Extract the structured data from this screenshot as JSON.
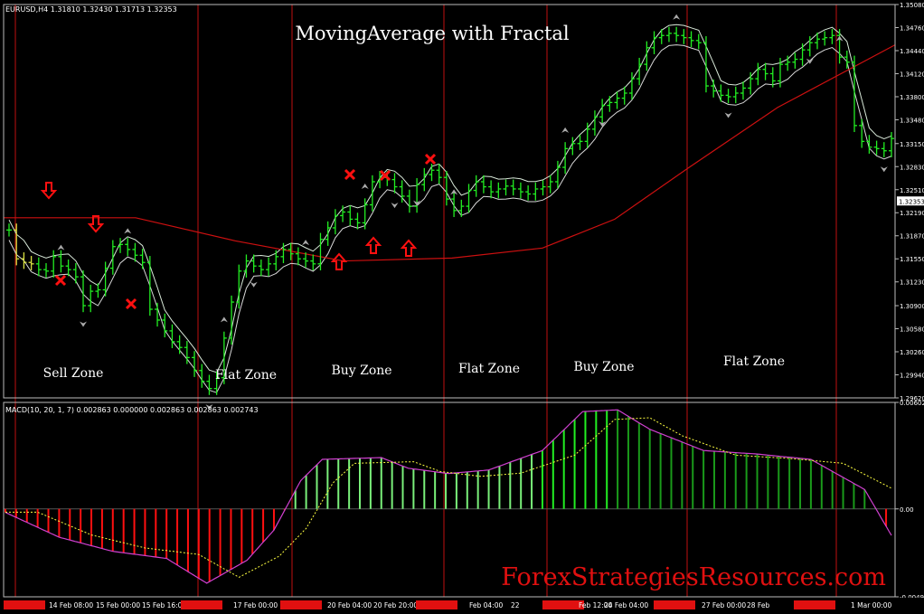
{
  "chart_data": [
    {
      "type": "candlestick",
      "symbol_info": "EURUSD,H4  1.31810 1.32430 1.31713 1.32353",
      "title": "MovingAverage with Fractal",
      "current_price_label": "1.32353",
      "ylim": [
        1.2962,
        1.3508
      ],
      "y_ticks": [
        "1.35080",
        "1.34760",
        "1.34440",
        "1.34120",
        "1.33800",
        "1.33480",
        "1.33150",
        "1.32830",
        "1.32510",
        "1.32190",
        "1.31870",
        "1.31550",
        "1.31230",
        "1.30900",
        "1.30580",
        "1.30260",
        "1.29940",
        "1.29620"
      ],
      "zones": [
        {
          "label": "Sell Zone"
        },
        {
          "label": "Flat Zone"
        },
        {
          "label": "Buy Zone"
        },
        {
          "label": "Flat Zone"
        },
        {
          "label": "Buy Zone"
        },
        {
          "label": "Flat Zone"
        }
      ],
      "bar_close": [
        1.3195,
        1.3155,
        1.315,
        1.3148,
        1.314,
        1.3138,
        1.3158,
        1.3145,
        1.314,
        1.313,
        1.309,
        1.311,
        1.3112,
        1.3142,
        1.3172,
        1.3175,
        1.3168,
        1.316,
        1.315,
        1.3085,
        1.307,
        1.3055,
        1.304,
        1.3032,
        1.3018,
        1.3,
        1.2985,
        1.2975,
        1.299,
        1.3045,
        1.3095,
        1.3138,
        1.3152,
        1.3145,
        1.314,
        1.3148,
        1.3158,
        1.3168,
        1.3162,
        1.3155,
        1.3152,
        1.3148,
        1.3182,
        1.3198,
        1.3215,
        1.322,
        1.321,
        1.3205,
        1.323,
        1.3262,
        1.3268,
        1.3265,
        1.3255,
        1.3242,
        1.3228,
        1.3258,
        1.3272,
        1.3278,
        1.3268,
        1.3238,
        1.3222,
        1.3228,
        1.325,
        1.3262,
        1.3255,
        1.3248,
        1.3252,
        1.3256,
        1.3252,
        1.3248,
        1.3245,
        1.3252,
        1.3255,
        1.3262,
        1.3282,
        1.3308,
        1.3315,
        1.3318,
        1.3335,
        1.3352,
        1.3368,
        1.3372,
        1.3378,
        1.3385,
        1.3405,
        1.3425,
        1.3448,
        1.3462,
        1.3465,
        1.3468,
        1.3465,
        1.3462,
        1.3458,
        1.3455,
        1.3395,
        1.3388,
        1.3382,
        1.338,
        1.3385,
        1.3392,
        1.3405,
        1.3418,
        1.3412,
        1.3402,
        1.3425,
        1.3428,
        1.3432,
        1.3445,
        1.3455,
        1.346,
        1.3462,
        1.3465,
        1.3435,
        1.3428,
        1.334,
        1.3318,
        1.331,
        1.3308,
        1.3305,
        1.3322
      ],
      "series": [
        {
          "name": "MA upper envelope",
          "color": "#d8e8d8"
        },
        {
          "name": "MA lower envelope",
          "color": "#d8d8d8"
        },
        {
          "name": "Slow MA",
          "color": "#cc1010"
        }
      ],
      "fractals_up_bar_index": [
        7,
        16,
        29,
        40,
        48,
        60,
        75,
        90,
        112
      ],
      "fractals_down_bar_index": [
        10,
        27,
        33,
        52,
        55,
        80,
        97,
        108,
        118
      ]
    },
    {
      "type": "bar",
      "indicator_label": "MACD(10, 20, 1, 7) 0.002863 0.000000 0.002863 0.002863 0.002743",
      "ylim": [
        -0.00497,
        0.00602
      ],
      "y_ticks": [
        "0.00602",
        "0.00",
        "-0.00497"
      ],
      "signal_color": "#ffff40",
      "macd_line_color": "#d040d0",
      "positive_color": "#22c822",
      "negative_color": "#ff1010",
      "zero_value": 0.0
    }
  ],
  "x_labels": [
    "",
    "14 Feb 08:00",
    "15 Feb 00:00",
    "15 Feb 16:00",
    "",
    "17 Feb 00:00",
    "",
    "20 Feb 04:00",
    "20 Feb 20:00",
    "",
    "Feb 04:00",
    "22",
    "",
    "Feb 12:00",
    "24 Feb 04:00",
    "",
    "27 Feb 00:00",
    "28 Feb",
    "",
    "1 Mar 00:00"
  ],
  "watermark": "ForexStrategiesResources.com"
}
